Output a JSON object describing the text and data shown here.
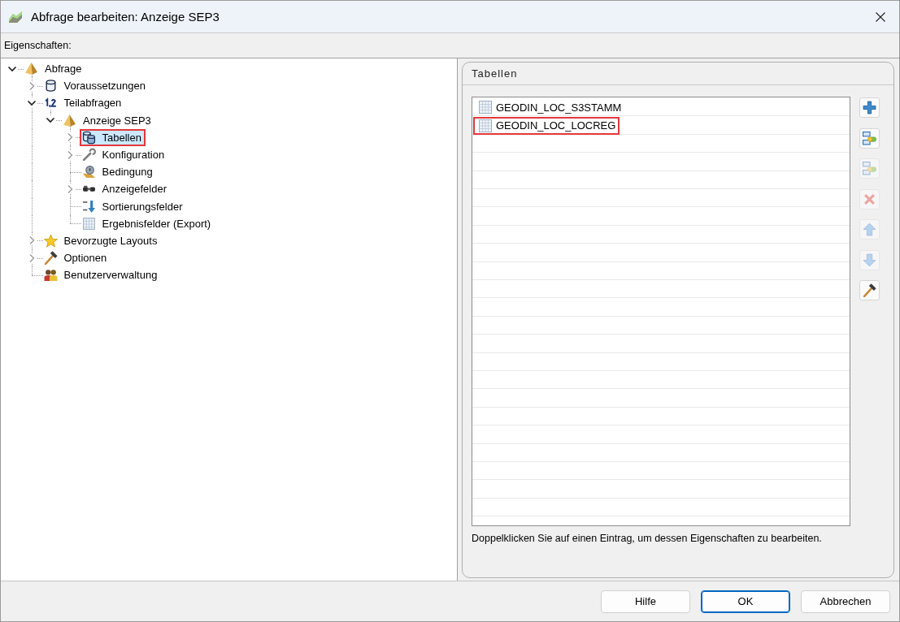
{
  "window": {
    "title": "Abfrage bearbeiten: Anzeige SEP3"
  },
  "properties_bar": {
    "label": "Eigenschaften:"
  },
  "tree": {
    "items": [
      {
        "label": "Abfrage",
        "kind": "query",
        "expandable": true,
        "expanded": true,
        "selected": false,
        "highlighted": false,
        "children": [
          {
            "label": "Voraussetzungen",
            "kind": "database",
            "expandable": true,
            "expanded": false,
            "selected": false,
            "highlighted": false
          },
          {
            "label": "Teilabfragen",
            "kind": "numbered",
            "expandable": true,
            "expanded": true,
            "selected": false,
            "highlighted": false,
            "children": [
              {
                "label": "Anzeige SEP3",
                "kind": "query",
                "expandable": true,
                "expanded": true,
                "selected": false,
                "highlighted": false,
                "children": [
                  {
                    "label": "Tabellen",
                    "kind": "tables",
                    "expandable": true,
                    "expanded": false,
                    "selected": true,
                    "highlighted": true
                  },
                  {
                    "label": "Konfiguration",
                    "kind": "wrench",
                    "expandable": true,
                    "expanded": false,
                    "selected": false,
                    "highlighted": false
                  },
                  {
                    "label": "Bedingung",
                    "kind": "condition",
                    "expandable": false,
                    "selected": false,
                    "highlighted": false
                  },
                  {
                    "label": "Anzeigefelder",
                    "kind": "fields",
                    "expandable": true,
                    "expanded": false,
                    "selected": false,
                    "highlighted": false
                  },
                  {
                    "label": "Sortierungsfelder",
                    "kind": "sort",
                    "expandable": false,
                    "selected": false,
                    "highlighted": false
                  },
                  {
                    "label": "Ergebnisfelder (Export)",
                    "kind": "grid",
                    "expandable": false,
                    "selected": false,
                    "highlighted": false
                  }
                ]
              }
            ]
          },
          {
            "label": "Bevorzugte Layouts",
            "kind": "star",
            "expandable": true,
            "expanded": false,
            "selected": false,
            "highlighted": false
          },
          {
            "label": "Optionen",
            "kind": "hammer",
            "expandable": true,
            "expanded": false,
            "selected": false,
            "highlighted": false
          },
          {
            "label": "Benutzerverwaltung",
            "kind": "users",
            "expandable": false,
            "selected": false,
            "highlighted": false
          }
        ]
      }
    ]
  },
  "panel": {
    "title": "Tabellen",
    "list": {
      "rows": [
        {
          "label": "GEODIN_LOC_S3STAMM",
          "selected": false,
          "highlighted": false
        },
        {
          "label": "GEODIN_LOC_LOCREG",
          "selected": false,
          "highlighted": true
        }
      ]
    },
    "toolbar": [
      {
        "kind": "add",
        "disabled": false
      },
      {
        "kind": "link",
        "disabled": false
      },
      {
        "kind": "unlink",
        "disabled": true
      },
      {
        "kind": "delete",
        "disabled": true
      },
      {
        "kind": "up",
        "disabled": true
      },
      {
        "kind": "down",
        "disabled": true
      },
      {
        "kind": "hammer",
        "disabled": false
      }
    ],
    "hint": "Doppelklicken Sie auf einen Eintrag, um dessen Eigenschaften zu bearbeiten."
  },
  "buttons": [
    {
      "label": "Hilfe",
      "default": false
    },
    {
      "label": "OK",
      "default": true
    },
    {
      "label": "Abbrechen",
      "default": false
    }
  ]
}
